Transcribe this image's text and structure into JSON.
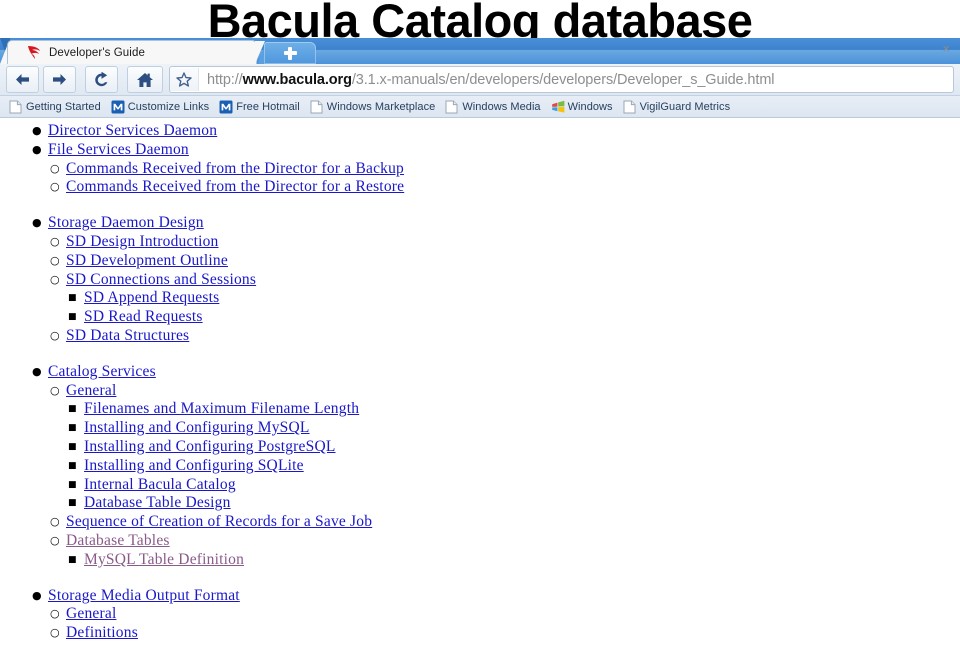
{
  "slide": {
    "title": "Bacula Catalog database"
  },
  "browser": {
    "tab": {
      "title": "Developer's Guide",
      "favicon_name": "bacula-feather-icon",
      "close_label": "×"
    },
    "new_tab_label": "+",
    "toolbar": {
      "back_label": "Back",
      "forward_label": "Forward",
      "reload_label": "Reload",
      "home_label": "Home",
      "bookmark_star_label": "Bookmark this page"
    },
    "address_bar": {
      "scheme": "http://",
      "host": "www.bacula.org",
      "path": "/3.1.x-manuals/en/developers/developers/Developer_s_Guide.html",
      "full_url": "http://www.bacula.org/3.1.x-manuals/en/developers/developers/Developer_s_Guide.html"
    },
    "bookmarks": [
      {
        "label": "Getting Started",
        "icon": "page-icon"
      },
      {
        "label": "Customize Links",
        "icon": "msn-m-icon"
      },
      {
        "label": "Free Hotmail",
        "icon": "msn-m-icon"
      },
      {
        "label": "Windows Marketplace",
        "icon": "page-icon"
      },
      {
        "label": "Windows Media",
        "icon": "page-icon"
      },
      {
        "label": "Windows",
        "icon": "windows-flag-icon"
      },
      {
        "label": "VigilGuard Metrics",
        "icon": "page-icon"
      }
    ]
  },
  "page": {
    "link_color": "#1a18c9",
    "visited_link_color": "#8a5a8a",
    "groups": [
      {
        "items": [
          {
            "level": 1,
            "label": "Director Services Daemon",
            "visited": false
          },
          {
            "level": 1,
            "label": "File Services Daemon",
            "visited": false
          },
          {
            "level": 2,
            "label": "Commands Received from the Director for a Backup",
            "visited": false
          },
          {
            "level": 2,
            "label": "Commands Received from the Director for a Restore",
            "visited": false
          }
        ]
      },
      {
        "items": [
          {
            "level": 1,
            "label": "Storage Daemon Design",
            "visited": false
          },
          {
            "level": 2,
            "label": "SD Design Introduction",
            "visited": false
          },
          {
            "level": 2,
            "label": "SD Development Outline",
            "visited": false
          },
          {
            "level": 2,
            "label": "SD Connections and Sessions",
            "visited": false
          },
          {
            "level": 3,
            "label": "SD Append Requests",
            "visited": false
          },
          {
            "level": 3,
            "label": "SD Read Requests",
            "visited": false
          },
          {
            "level": 2,
            "label": "SD Data Structures",
            "visited": false
          }
        ]
      },
      {
        "items": [
          {
            "level": 1,
            "label": "Catalog Services",
            "visited": false
          },
          {
            "level": 2,
            "label": "General",
            "visited": false
          },
          {
            "level": 3,
            "label": "Filenames and Maximum Filename Length",
            "visited": false
          },
          {
            "level": 3,
            "label": "Installing and Configuring MySQL",
            "visited": false
          },
          {
            "level": 3,
            "label": "Installing and Configuring PostgreSQL",
            "visited": false
          },
          {
            "level": 3,
            "label": "Installing and Configuring SQLite",
            "visited": false
          },
          {
            "level": 3,
            "label": "Internal Bacula Catalog",
            "visited": false
          },
          {
            "level": 3,
            "label": "Database Table Design",
            "visited": false
          },
          {
            "level": 2,
            "label": "Sequence of Creation of Records for a Save Job",
            "visited": false
          },
          {
            "level": 2,
            "label": "Database Tables",
            "visited": true
          },
          {
            "level": 3,
            "label": "MySQL Table Definition",
            "visited": true
          }
        ]
      },
      {
        "items": [
          {
            "level": 1,
            "label": "Storage Media Output Format",
            "visited": false
          },
          {
            "level": 2,
            "label": "General",
            "visited": false
          },
          {
            "level": 2,
            "label": "Definitions",
            "visited": false
          }
        ]
      }
    ]
  }
}
